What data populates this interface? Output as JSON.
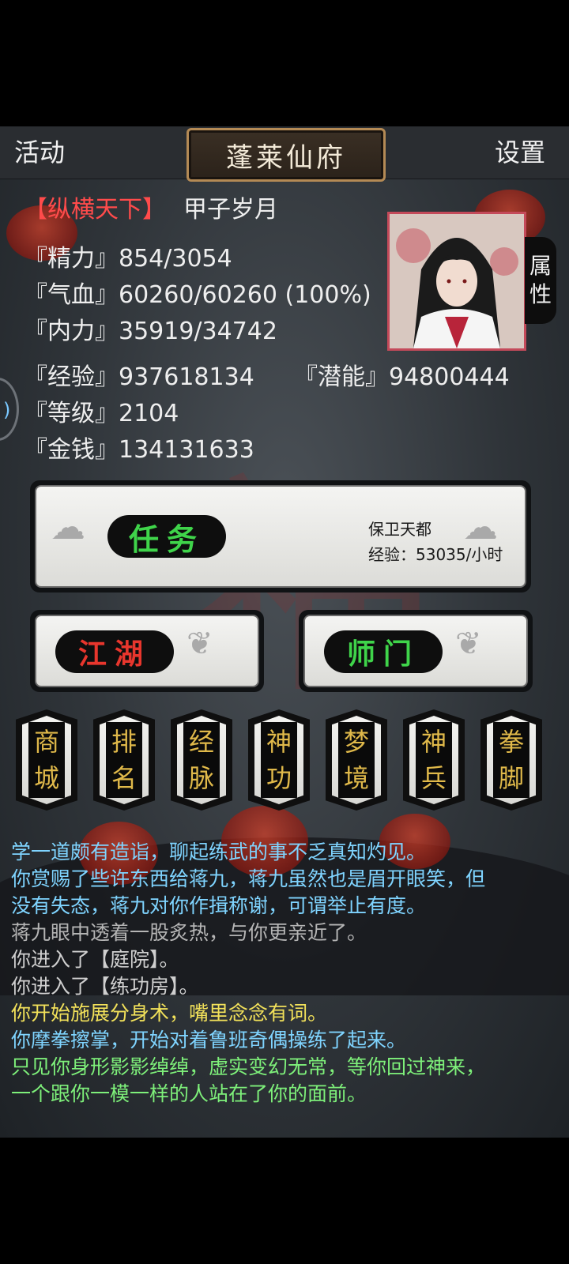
{
  "topbar": {
    "left_label": "活动",
    "title": "蓬莱仙府",
    "right_label": "设置"
  },
  "header": {
    "tag": "【纵横天下】",
    "era": "甲子岁月"
  },
  "stats": {
    "energy": "『精力』854/3054",
    "hp": "『气血』60260/60260 (100%)",
    "inner": "『内力』35919/34742",
    "exp": "『经验』937618134",
    "potential": "『潜能』94800444",
    "level": "『等级』2104",
    "money": "『金钱』134131633"
  },
  "attr_tab": {
    "line1": "属",
    "line2": "性"
  },
  "task": {
    "label": "任务",
    "name": "保卫天都",
    "rate": "经验：53035/小时"
  },
  "buttons": {
    "jianghu": "江湖",
    "shimen": "师门"
  },
  "menu": [
    {
      "top": "商",
      "bottom": "城"
    },
    {
      "top": "排",
      "bottom": "名"
    },
    {
      "top": "经",
      "bottom": "脉"
    },
    {
      "top": "神",
      "bottom": "功"
    },
    {
      "top": "梦",
      "bottom": "境"
    },
    {
      "top": "神",
      "bottom": "兵"
    },
    {
      "top": "拳",
      "bottom": "脚"
    }
  ],
  "log": [
    {
      "text": "学一道颇有造诣，聊起练武的事不乏真知灼见。",
      "color": "#7fd4ff"
    },
    {
      "text": "你赏赐了些许东西给蒋九，蒋九虽然也是眉开眼笑，但",
      "color": "#7fd4ff"
    },
    {
      "text": "没有失态，蒋九对你作揖称谢，可谓举止有度。",
      "color": "#7fd4ff"
    },
    {
      "text": "蒋九眼中透着一股炙热，与你更亲近了。",
      "color": "#b5b5b5"
    },
    {
      "text": "你进入了【庭院】。",
      "color": "#cfcfcf"
    },
    {
      "text": "你进入了【练功房】。",
      "color": "#cfcfcf"
    },
    {
      "text": "你开始施展分身术，嘴里念念有词。",
      "color": "#f2e15a"
    },
    {
      "text": "你摩拳擦掌，开始对着鲁班奇偶操练了起来。",
      "color": "#7fd4ff"
    },
    {
      "text": "只见你身形影影绰绰，虚实变幻无常，等你回过神来，",
      "color": "#7ef07a"
    },
    {
      "text": "一个跟你一模一样的人站在了你的面前。",
      "color": "#7ef07a"
    }
  ],
  "colors": {
    "task_label": "#3fd44a",
    "jianghu_label": "#e8362d",
    "shimen_label": "#3fd44a",
    "tile_text": "#e0b94a"
  }
}
